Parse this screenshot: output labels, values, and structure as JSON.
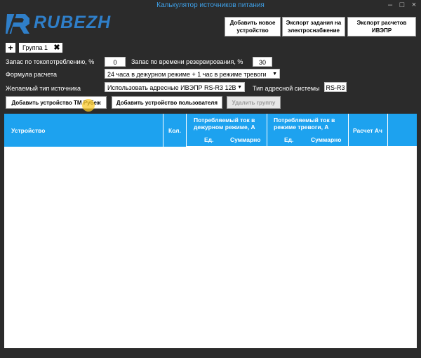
{
  "window": {
    "title": "Калькулятор источников питания",
    "controls": [
      "–",
      "□",
      "×"
    ]
  },
  "logo": {
    "text": "RUBEZH"
  },
  "toolbar": {
    "add_device": "Добавить новое устройство",
    "export_task": "Экспорт задания на электроснабжение",
    "export_calc": "Экспорт расчетов ИВЭПР"
  },
  "tabs": {
    "add": "+",
    "items": [
      {
        "label": "Группа 1",
        "close": "✖"
      }
    ]
  },
  "form": {
    "current_reserve_label": "Запас по токопотреблению, %",
    "current_reserve_value": "0",
    "time_reserve_label": "Запас по времени резервирования, %",
    "time_reserve_value": "30",
    "formula_label": "Формула расчета",
    "formula_value": "24 часа в дежурном режиме + 1 час в режиме тревоги",
    "source_type_label": "Желаемый тип источника",
    "source_type_value": "Использовать адресные ИВЭПР RS-R3 12В",
    "address_system_label": "Тип адресной системы",
    "address_system_value": "RS-R3"
  },
  "actions": {
    "add_rubezh": "Добавить устройство ТМ Рубеж",
    "add_user": "Добавить устройство пользователя",
    "delete_group": "Удалить группу"
  },
  "table": {
    "col_device": "Устройство",
    "col_qty": "Кол.",
    "col_standby": "Потребляемый ток в дежурном режиме, А",
    "col_alarm": "Потребляемый ток в режиме тревоги, А",
    "col_calc": "Расчет Ач",
    "sub_unit": "Ед.",
    "sub_total": "Суммарно",
    "rows": []
  },
  "colors": {
    "accent": "#1da2ef",
    "background": "#2b2b2b",
    "logo": "#2f7fc9"
  }
}
